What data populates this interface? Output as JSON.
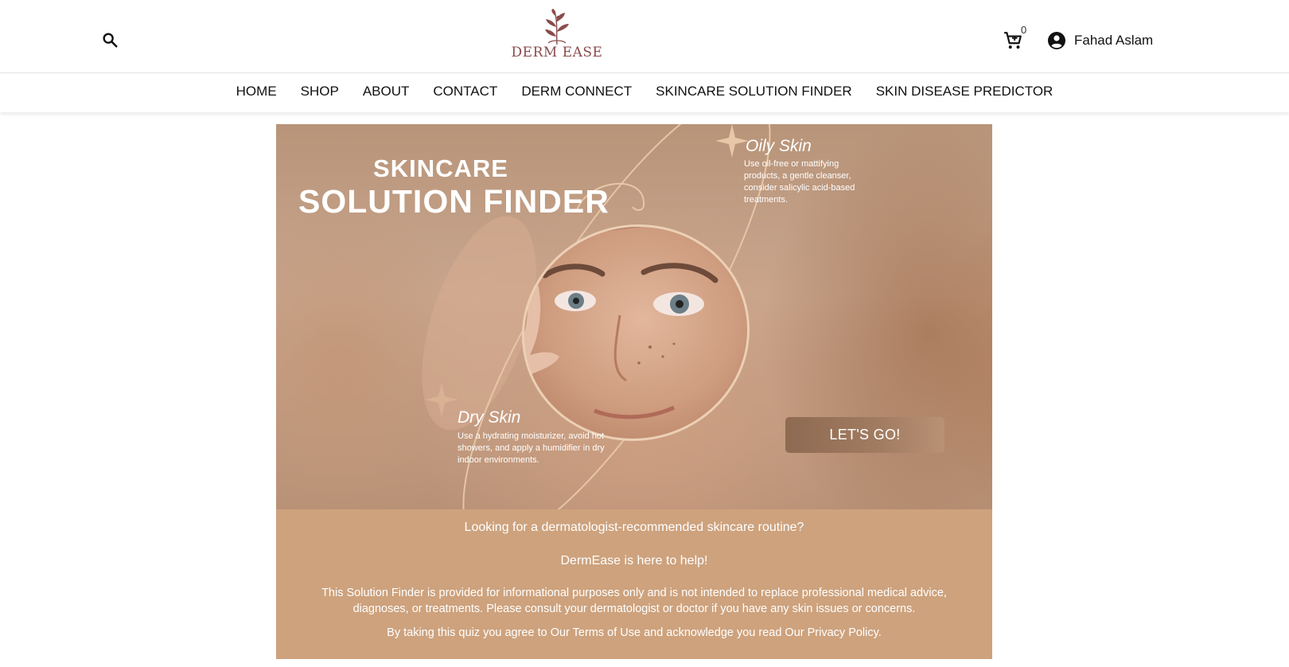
{
  "header": {
    "logo_text": "DERM EASE",
    "cart_count": "0",
    "user_name": "Fahad Aslam"
  },
  "nav": {
    "items": [
      {
        "label": "HOME"
      },
      {
        "label": "SHOP"
      },
      {
        "label": "ABOUT"
      },
      {
        "label": "CONTACT"
      },
      {
        "label": "DERM CONNECT"
      },
      {
        "label": "SKINCARE SOLUTION FINDER"
      },
      {
        "label": "SKIN DISEASE PREDICTOR"
      }
    ]
  },
  "hero": {
    "title_line1": "SKINCARE",
    "title_line2": "SOLUTION FINDER",
    "oily": {
      "title": "Oily Skin",
      "text": "Use oil-free or mattifying products, a gentle cleanser, consider salicylic acid-based treatments."
    },
    "dry": {
      "title": "Dry Skin",
      "text": "Use a hydrating moisturizer, avoid hot showers, and apply a humidifier in dry indoor environments."
    },
    "cta_label": "LET'S GO!"
  },
  "info": {
    "question": "Looking for a dermatologist-recommended skincare routine?",
    "help": "DermEase is here to help!",
    "disclaimer": "This Solution Finder is provided for informational purposes only and is not intended to replace professional medical advice, diagnoses, or treatments. Please consult your dermatologist or doctor if you have any skin issues or concerns.",
    "agree": "By taking this quiz you agree to Our Terms of Use and acknowledge you read Our Privacy Policy."
  },
  "colors": {
    "brand": "#8a4b4b",
    "panel": "#cda27d",
    "accent_line": "#e8c7a8"
  },
  "icons": {
    "search": "search-icon",
    "cart": "cart-icon",
    "user": "account-circle-icon",
    "sparkle": "sparkle-icon"
  }
}
